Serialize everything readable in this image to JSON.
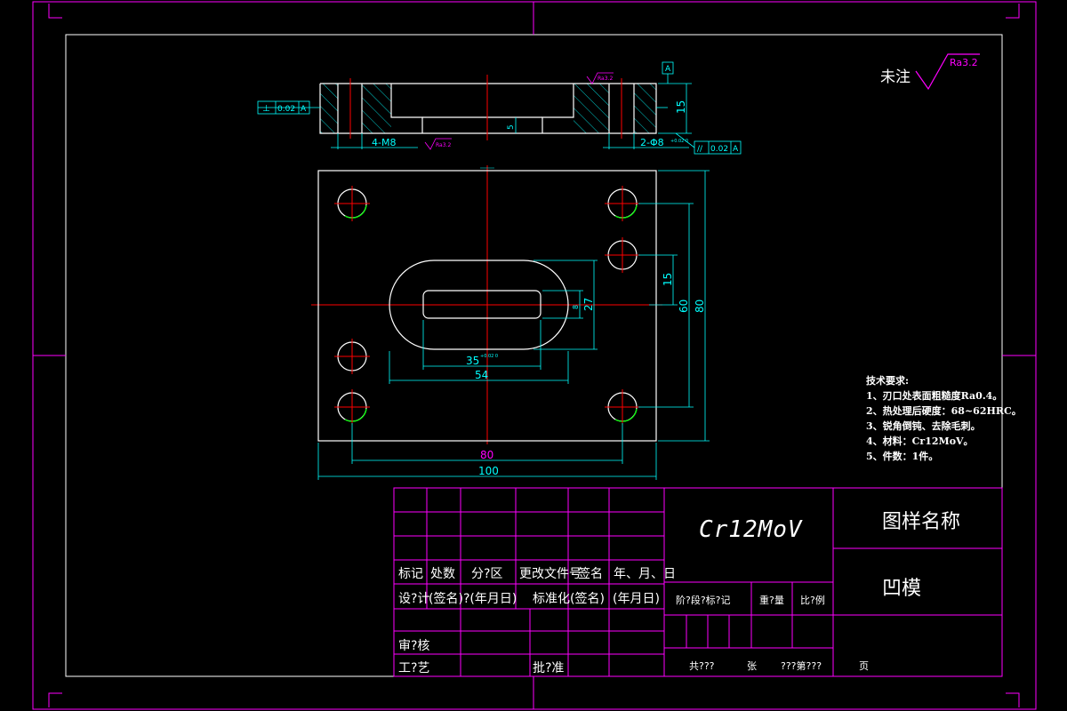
{
  "roughness_note": {
    "prefix": "未注",
    "value": "Ra3.2"
  },
  "tech_requirements": {
    "title": "技术要求:",
    "items": [
      "1、刃口处表面粗糙度Ra0.4。",
      "2、热处理后硬度：68~62HRC。",
      "3、锐角倒钝、去除毛刺。",
      "4、材料：Cr12MoV。",
      "5、件数：1件。"
    ]
  },
  "dimensions": {
    "overall_width": "100",
    "hole_spacing_x": "80",
    "overall_height": "80",
    "hole_spacing_y": "60",
    "side_hole_offset": "15",
    "slot_outer_length": "54",
    "slot_inner_length": "35",
    "slot_inner_tol": "+0.02 0",
    "slot_outer_width": "27",
    "slot_inner_width": "8",
    "thickness": "15",
    "pocket_depth": "5",
    "thread_callout": "4-M8",
    "pin_hole_callout": "2-Φ8",
    "pin_hole_tol": "+0.02 0",
    "surface_finish_local": "Ra3.2",
    "surface_finish_bottom": "Ra3.2"
  },
  "tolerances": {
    "perpendicularity": {
      "symbol": "⊥",
      "value": "0.02",
      "datum": "A"
    },
    "parallelism": {
      "symbol": "//",
      "value": "0.02",
      "datum": "A"
    },
    "datum_label": "A"
  },
  "title_block": {
    "headers": [
      "标记",
      "处数",
      "分?区",
      "更改文件号",
      "签名",
      "年、月、日"
    ],
    "row_design": [
      "设?计",
      "(签名)",
      "?(年月日)",
      "标准化",
      "(签名)",
      "(年月日)"
    ],
    "review_label": "审?核",
    "process_label": "工?艺",
    "approve_label": "批?准",
    "material": "Cr12MoV",
    "drawing_name_label": "图样名称",
    "part_name": "凹模",
    "stage_mark_label": "阶?段?标?记",
    "weight_label": "重?量",
    "scale_label": "比?例",
    "sheets_total": "共???",
    "sheets_unit": "张",
    "sheet_number": "???第???",
    "page_label": "页"
  },
  "colors": {
    "frame": "#ff00ff",
    "outline": "#ffffff",
    "centerline": "#ff0000",
    "dimension": "#00ffff",
    "hatch": "#00ffff",
    "circle_accent": "#00ff00",
    "annotation_text": "#ff00ff"
  }
}
